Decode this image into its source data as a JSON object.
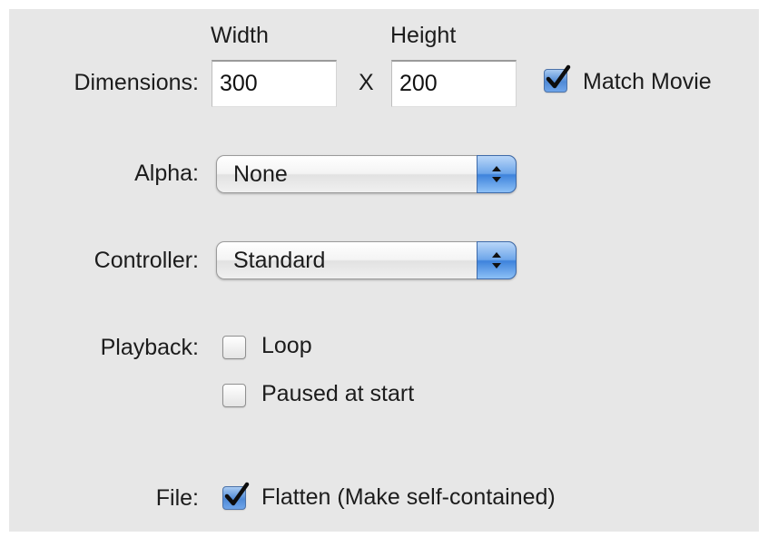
{
  "dimensions": {
    "label": "Dimensions:",
    "width_header": "Width",
    "height_header": "Height",
    "width_value": "300",
    "separator": "X",
    "height_value": "200",
    "match_movie": {
      "label": "Match Movie",
      "checked": true
    }
  },
  "alpha": {
    "label": "Alpha:",
    "selected": "None",
    "icon": "chevron-up-down-icon"
  },
  "controller": {
    "label": "Controller:",
    "selected": "Standard",
    "icon": "chevron-up-down-icon"
  },
  "playback": {
    "label": "Playback:",
    "loop": {
      "label": "Loop",
      "checked": false
    },
    "paused_at_start": {
      "label": "Paused at start",
      "checked": false
    }
  },
  "file": {
    "label": "File:",
    "flatten": {
      "label": "Flatten (Make self-contained)",
      "checked": true
    }
  },
  "colors": {
    "panel_background": "#e7e7e7",
    "accent_blue": "#4f8ad6",
    "text": "#1c1c1c"
  }
}
